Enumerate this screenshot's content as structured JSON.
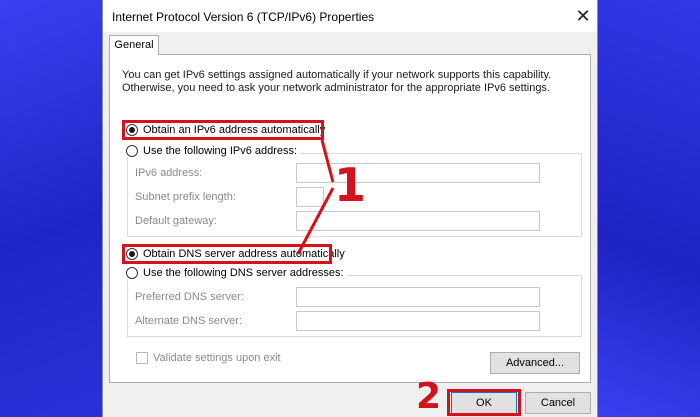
{
  "window": {
    "title": "Internet Protocol Version 6 (TCP/IPv6) Properties",
    "close_glyph": "✕"
  },
  "tabs": [
    {
      "label": "General",
      "selected": true
    }
  ],
  "description": "You can get IPv6 settings assigned automatically if your network supports this capability. Otherwise, you need to ask your network administrator for the appropriate IPv6 settings.",
  "ip_section": {
    "auto_option": {
      "label": "Obtain an IPv6 address automatically",
      "selected": true
    },
    "manual_option": {
      "label": "Use the following IPv6 address:",
      "selected": false
    },
    "fields": [
      {
        "label": "IPv6 address:",
        "value": ""
      },
      {
        "label": "Subnet prefix length:",
        "value": ""
      },
      {
        "label": "Default gateway:",
        "value": ""
      }
    ]
  },
  "dns_section": {
    "auto_option": {
      "label": "Obtain DNS server address automatically",
      "selected": true
    },
    "manual_option": {
      "label": "Use the following DNS server addresses:",
      "selected": false
    },
    "fields": [
      {
        "label": "Preferred DNS server:",
        "value": ""
      },
      {
        "label": "Alternate DNS server:",
        "value": ""
      }
    ]
  },
  "validate_checkbox": {
    "label": "Validate settings upon exit",
    "checked": false
  },
  "buttons": {
    "advanced": "Advanced...",
    "ok": "OK",
    "cancel": "Cancel"
  },
  "annotations": {
    "step1": "1",
    "step2": "2",
    "highlight_color": "#d3121b"
  },
  "colors": {
    "background": "#2a2fd8",
    "dialog": "#f0f0f0",
    "panel": "#ffffff",
    "default_button_border": "#0078d7"
  }
}
